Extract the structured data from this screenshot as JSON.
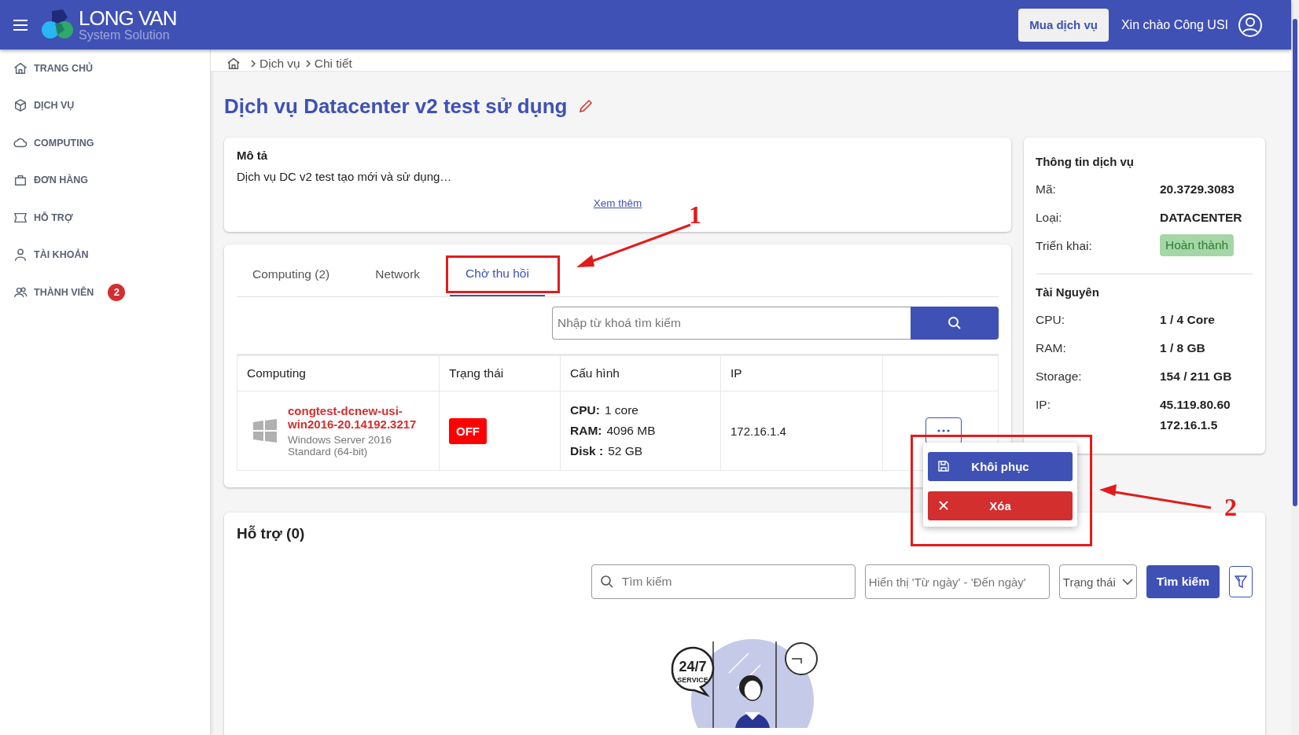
{
  "header": {
    "brand": "LONG VAN",
    "brand_sub": "System Solution",
    "buy_button": "Mua dịch vụ",
    "greeting": "Xin chào Công USI"
  },
  "sidebar": {
    "items": [
      {
        "label": "TRANG CHỦ",
        "selected": false
      },
      {
        "label": "DỊCH VỤ",
        "selected": false
      },
      {
        "label": "COMPUTING",
        "selected": false
      },
      {
        "label": "ĐƠN HÀNG",
        "selected": false
      },
      {
        "label": "HỖ TRỢ",
        "selected": false
      },
      {
        "label": "TÀI KHOẢN",
        "selected": false
      },
      {
        "label": "THÀNH VIÊN",
        "selected": false,
        "badge": "2"
      }
    ]
  },
  "breadcrumb": [
    "Dịch vụ",
    "Chi tiết"
  ],
  "title": "Dịch vụ Datacenter v2 test sử dụng",
  "description": {
    "heading": "Mô tả",
    "text": "Dịch vụ DC v2 test tạo mới và sử dụng…",
    "more_link": "Xem thêm"
  },
  "tabs": [
    {
      "label": "Computing (2)",
      "selected": false
    },
    {
      "label": "Network",
      "selected": false
    },
    {
      "label": "Chờ thu hồi",
      "selected": true
    }
  ],
  "search": {
    "placeholder": "Nhập từ khoá tìm kiếm"
  },
  "table": {
    "columns": [
      "Computing",
      "Trạng thái",
      "Cấu hình",
      "IP"
    ],
    "rows": [
      {
        "name": "congtest-dcnew-usi-win2016-20.14192.3217",
        "os": "Windows Server 2016 Standard (64-bit)",
        "status": "OFF",
        "config": [
          {
            "label": "CPU:",
            "value": "1 core"
          },
          {
            "label": "RAM:",
            "value": "4096 MB"
          },
          {
            "label": "Disk :",
            "value": "52 GB"
          }
        ],
        "ip": "172.16.1.4"
      }
    ]
  },
  "row_menu": {
    "items": [
      {
        "label": "Khôi phục",
        "kind": "restore"
      },
      {
        "label": "Xóa",
        "kind": "delete"
      }
    ]
  },
  "service_info": {
    "title": "Thông tin dịch vụ",
    "fields": [
      {
        "label": "Mã:",
        "values": [
          "20.3729.3083"
        ]
      },
      {
        "label": "Loại:",
        "values": [
          "DATACENTER"
        ]
      },
      {
        "label": "Triển khai:",
        "values": [
          "Hoàn thành"
        ],
        "kind": "badge"
      }
    ],
    "resources_title": "Tài Nguyên",
    "resources": [
      {
        "label": "CPU:",
        "values": [
          "1 / 4 Core"
        ]
      },
      {
        "label": "RAM:",
        "values": [
          "1 / 8 GB"
        ]
      },
      {
        "label": "Storage:",
        "values": [
          "154 / 211 GB"
        ]
      },
      {
        "label": "IP:",
        "values": [
          "45.119.80.60",
          "172.16.1.5"
        ]
      }
    ]
  },
  "support": {
    "title": "Hỗ trợ (0)",
    "search_placeholder": "Tìm kiếm",
    "date_placeholder": "Hiển thị 'Từ ngày' - 'Đến ngày'",
    "status_select": "Trạng thái",
    "search_button": "Tìm kiếm",
    "illustration_text": [
      "24/7",
      "SERVICE"
    ]
  },
  "annotations": [
    {
      "number": "1"
    },
    {
      "number": "2"
    }
  ]
}
